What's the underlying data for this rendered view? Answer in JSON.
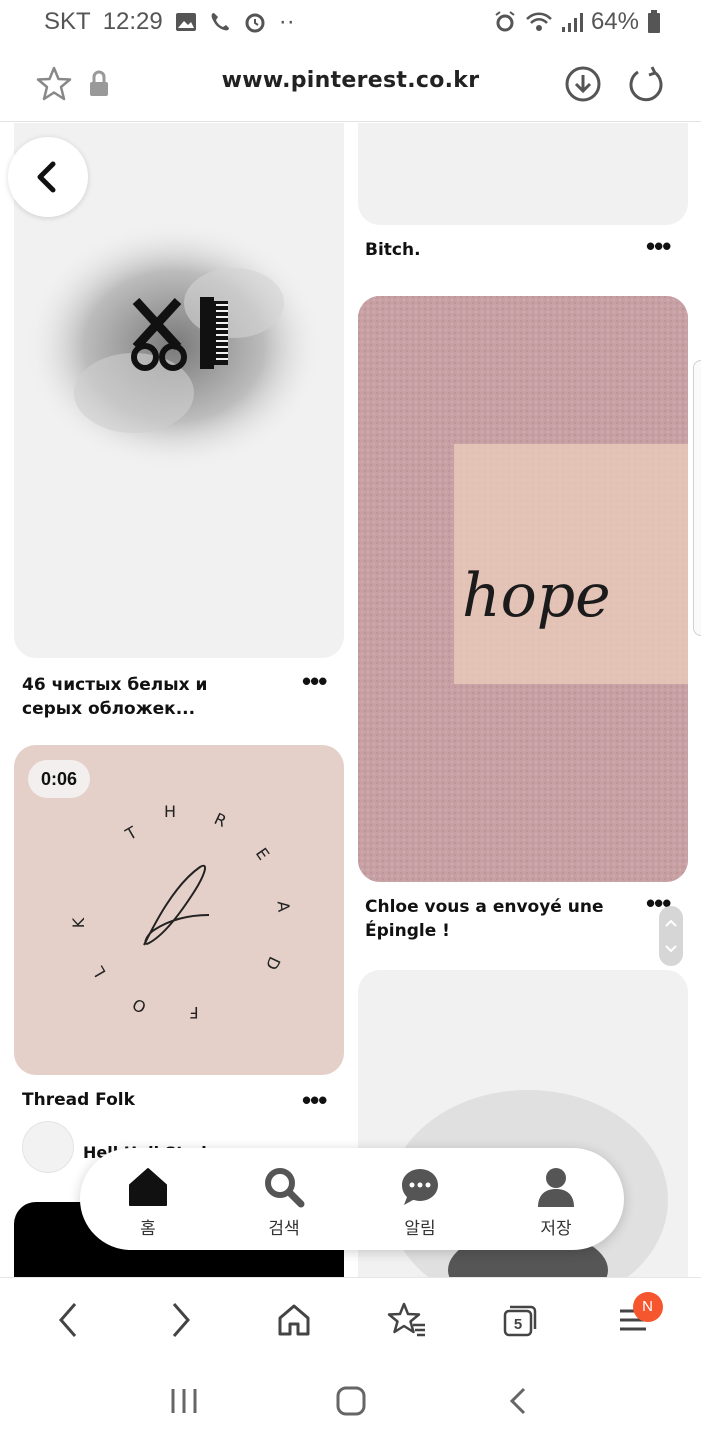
{
  "status_bar": {
    "carrier": "SKT",
    "time": "12:29",
    "battery": "64%",
    "dots": "··"
  },
  "browser": {
    "url": "www.pinterest.co.kr"
  },
  "feed": {
    "pins": [
      {
        "caption_line1": "46 чистых белых и",
        "caption_line2": "серых обложек..."
      },
      {
        "badge": "0:06",
        "caption": "Thread Folk",
        "sub": "Hell  Holl  Stud"
      },
      {
        "caption": "Bitch."
      },
      {
        "caption_line1": "Chloe vous a envoyé une",
        "caption_line2": "Épingle !"
      }
    ],
    "more_label": "•••",
    "hope_text": "hope",
    "thread_letters": [
      "T",
      "H",
      "R",
      "E",
      "A",
      "D",
      "F",
      "O",
      "L",
      "K"
    ]
  },
  "pin_nav": {
    "items": [
      {
        "label": "홈",
        "icon": "home-icon"
      },
      {
        "label": "검색",
        "icon": "search-icon"
      },
      {
        "label": "알림",
        "icon": "chat-icon"
      },
      {
        "label": "저장",
        "icon": "profile-icon"
      }
    ]
  },
  "toolbar": {
    "tab_count": "5",
    "menu_badge": "N"
  }
}
